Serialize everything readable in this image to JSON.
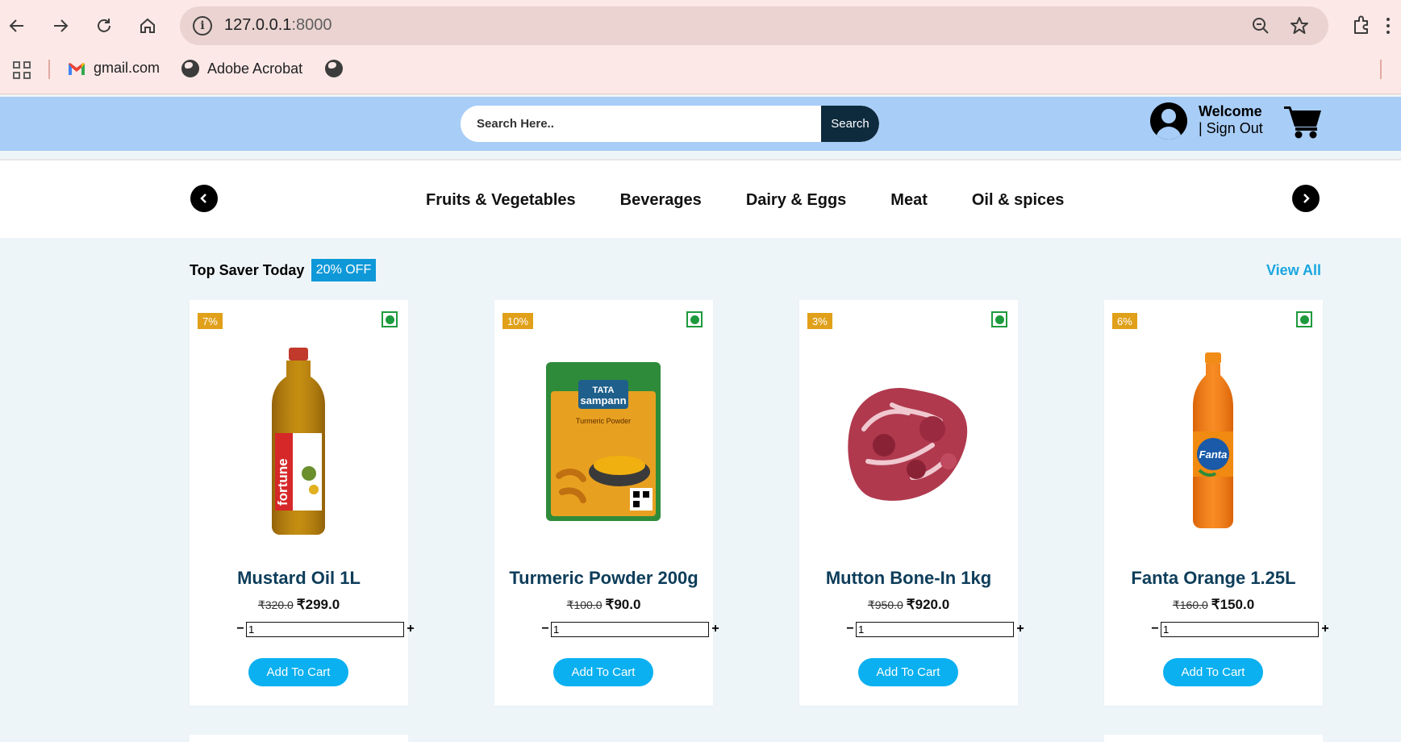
{
  "browser": {
    "url_host": "127.0.0.1",
    "url_port": ":8000",
    "bookmarks": [
      {
        "label": "gmail.com",
        "icon": "gmail-icon"
      },
      {
        "label": "Adobe Acrobat",
        "icon": "globe-icon"
      },
      {
        "label": "",
        "icon": "globe-icon"
      }
    ]
  },
  "header": {
    "search_placeholder": "Search Here..",
    "search_button": "Search",
    "welcome": "Welcome",
    "sign_out": "| Sign Out"
  },
  "categories": [
    "Fruits & Vegetables",
    "Beverages",
    "Dairy & Eggs",
    "Meat",
    "Oil & spices"
  ],
  "section": {
    "title": "Top Saver Today",
    "badge": "20% OFF",
    "view_all": "View All"
  },
  "products": [
    {
      "discount": "7%",
      "name": "Mustard Oil 1L",
      "old_price": "₹320.0",
      "price": "₹299.0",
      "qty": "1",
      "add_label": "Add To Cart"
    },
    {
      "discount": "10%",
      "name": "Turmeric Powder 200g",
      "old_price": "₹100.0",
      "price": "₹90.0",
      "qty": "1",
      "add_label": "Add To Cart"
    },
    {
      "discount": "3%",
      "name": "Mutton Bone-In 1kg",
      "old_price": "₹950.0",
      "price": "₹920.0",
      "qty": "1",
      "add_label": "Add To Cart"
    },
    {
      "discount": "6%",
      "name": "Fanta Orange 1.25L",
      "old_price": "₹160.0",
      "price": "₹150.0",
      "qty": "1",
      "add_label": "Add To Cart"
    }
  ],
  "product_image_labels": {
    "fortune": "fortune",
    "tata": "TATA",
    "sampann": "sampann",
    "turmeric": "Turmeric Powder",
    "fanta": "Fanta"
  },
  "colors": {
    "header_bg": "#a8cdf7",
    "accent": "#0ab0f0",
    "discount_badge": "#e0a01a",
    "veg_green": "#1e9a3e"
  }
}
